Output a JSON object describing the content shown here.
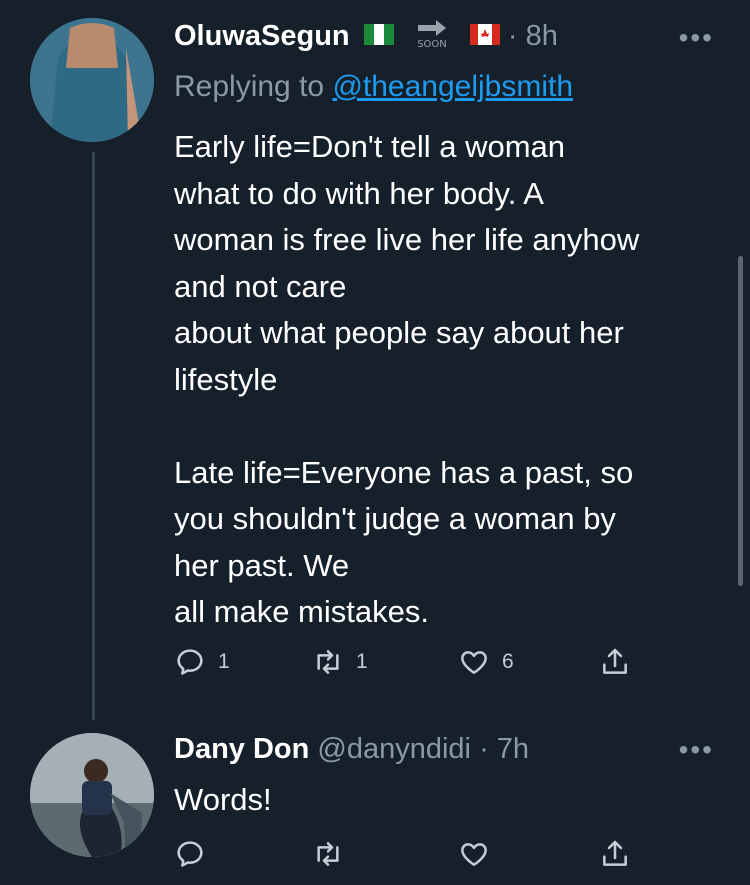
{
  "tweet1": {
    "name": "OluwaSegun",
    "badge_text": "SOON",
    "time": "· 8h",
    "more": "•••",
    "replying_prefix": "Replying to ",
    "replying_handle": "@theangeljbsmith",
    "body": "Early life=Don't tell a woman\nwhat to do with her body. A\nwoman is free live her life anyhow\nand not care\nabout what people say about her\nlifestyle\n\nLate life=Everyone has a past, so\nyou shouldn't judge a woman by\nher past. We\nall make mistakes.",
    "reply_count": "1",
    "retweet_count": "1",
    "like_count": "6"
  },
  "tweet2": {
    "name": "Dany Don",
    "handle": "@danyndidi",
    "time": "· 7h",
    "more": "•••",
    "body": "Words!"
  },
  "colors": {
    "background": "#15202b",
    "text": "#ffffff",
    "muted": "#8b98a5",
    "link": "#1d9bf0"
  }
}
